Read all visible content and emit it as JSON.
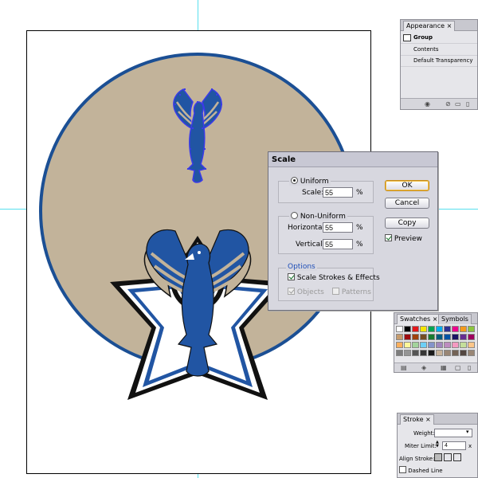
{
  "scale_dialog": {
    "title": "Scale",
    "uniform_label": "Uniform",
    "scale_label": "Scale:",
    "scale_value": "55",
    "percent": "%",
    "non_uniform_label": "Non-Uniform",
    "horizontal_label": "Horizontal:",
    "horizontal_value": "55",
    "vertical_label": "Vertical:",
    "vertical_value": "55",
    "options_title": "Options",
    "scale_strokes_label": "Scale Strokes & Effects",
    "objects_label": "Objects",
    "patterns_label": "Patterns",
    "ok_label": "OK",
    "cancel_label": "Cancel",
    "copy_label": "Copy",
    "preview_label": "Preview",
    "uniform_selected": true,
    "scale_strokes_checked": true,
    "objects_checked": true,
    "patterns_checked": false,
    "preview_checked": true
  },
  "appearance_panel": {
    "tab_label": "Appearance",
    "close_glyph": "×",
    "rows": [
      "Group",
      "Contents",
      "Default Transparency"
    ]
  },
  "swatches_panel": {
    "tabs": [
      "Swatches",
      "Symbols"
    ],
    "close_glyph": "×"
  },
  "stroke_panel": {
    "tab_label": "Stroke",
    "close_glyph": "×",
    "weight_label": "Weight:",
    "miter_label": "Miter Limit:",
    "miter_value": "4",
    "miter_unit": "x",
    "align_label": "Align Stroke:",
    "dashed_label": "Dashed Line"
  },
  "colors": {
    "tan": "#c2b39a",
    "navy": "#1b4f94",
    "blue": "#2155a3",
    "guide": "#58e0ee",
    "selection": "#3a3ae8"
  },
  "swatch_colors": [
    "#ffffff",
    "#000000",
    "#e2161b",
    "#f6e500",
    "#00a551",
    "#00aeef",
    "#2e3192",
    "#ec008c",
    "#f39a1d",
    "#8cc63f",
    "#c69c6d",
    "#9e0b0f",
    "#a0410d",
    "#754c24",
    "#197b30",
    "#005b7f",
    "#0054a6",
    "#1b1464",
    "#662d91",
    "#9e005d",
    "#fbaf5d",
    "#fff799",
    "#a3d39c",
    "#6dcff6",
    "#8393ca",
    "#a187be",
    "#bd8cbf",
    "#f49ac1",
    "#c4df9b",
    "#fdc689",
    "#7d7d7d",
    "#959595",
    "#555555",
    "#363636",
    "#1a1a1a",
    "#c7b299",
    "#998675",
    "#736357",
    "#534741",
    "#998675"
  ]
}
